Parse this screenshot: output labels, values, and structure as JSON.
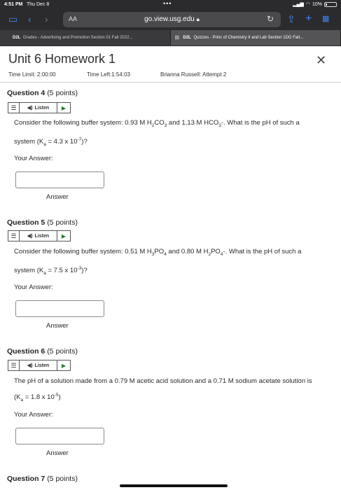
{
  "status_bar": {
    "time": "4:51 PM",
    "date": "Thu Dec 8",
    "battery": "10%"
  },
  "browser": {
    "text_size_button": "AA",
    "url": "go.view.usg.edu",
    "tabs": [
      {
        "favicon": "D2L",
        "label": "Grades - Advertising and Promotion Section 01 Fall 2022..."
      },
      {
        "favicon": "D2L",
        "label": "Quizzes - Princ of Chemistry II and Lab Section 1DG Fall..."
      }
    ]
  },
  "quiz": {
    "title": "Unit 6 Homework 1",
    "time_limit": "Time Limit: 2:00:00",
    "time_left": "Time Left:1:54:03",
    "attempt": "Brianna Russell: Attempt 2"
  },
  "listen_label": "Listen",
  "your_answer_label": "Your Answer:",
  "answer_label": "Answer",
  "questions": [
    {
      "title": "Question 4",
      "points": "(5 points)"
    },
    {
      "title": "Question 5",
      "points": "(5 points)"
    },
    {
      "title": "Question 6",
      "points": "(5 points)",
      "text": "The pH of a solution made from a 0.79 M acetic acid solution and a 0.71 M sodium acetate solution is (K"
    },
    {
      "title": "Question 7",
      "points": "(5 points)"
    }
  ],
  "q4": {
    "pre": "Consider the following buffer system: 0.93 M H",
    "s1": "2",
    "m1": "CO",
    "s2": "3",
    "m2": " and 1.13 M HCO",
    "s3": "3",
    "m3": "-. What is the pH of such a system (K",
    "s4": "a",
    "m4": " = 4.3 x 10",
    "sup": "-7",
    "post": ")?"
  },
  "q5": {
    "pre": "Consider the following buffer system: 0.51 M H",
    "s1": "3",
    "m1": "PO",
    "s2": "4",
    "m2": " and 0.80 M H",
    "s3": "2",
    "m3": "PO",
    "s4": "4",
    "m4": "-. What is the pH of such a system (K",
    "s5": "a",
    "m5": " = 7.5 x 10",
    "sup": "-3",
    "post": ")?"
  },
  "q6": {
    "sub": "a",
    "mid": " = 1.8 x 10",
    "sup": "-5",
    "post": ")"
  },
  "colors": {
    "accent": "#3d86f5",
    "play": "#2e7d32",
    "chrome": "#2b2b2d"
  }
}
